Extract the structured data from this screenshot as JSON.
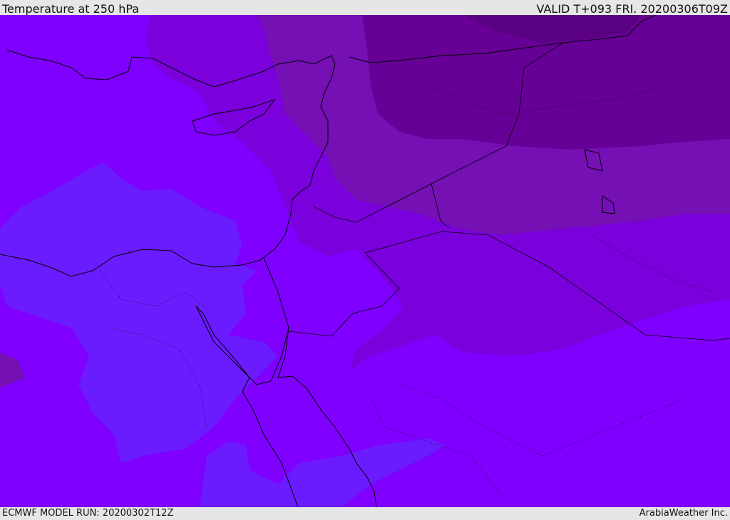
{
  "header": {
    "title": "Temperature at 250 hPa",
    "valid": "VALID T+093 FRI. 20200306T09Z"
  },
  "footer": {
    "model_run": "ECMWF MODEL RUN: 20200302T12Z",
    "credit": "ArabiaWeather Inc."
  },
  "map": {
    "colors": {
      "base": "#7f00ff",
      "cooler": "#6a1cff",
      "warm1": "#7a00dc",
      "warm2": "#7410b4",
      "warm3": "#660096",
      "warm4": "#5a0082"
    }
  }
}
